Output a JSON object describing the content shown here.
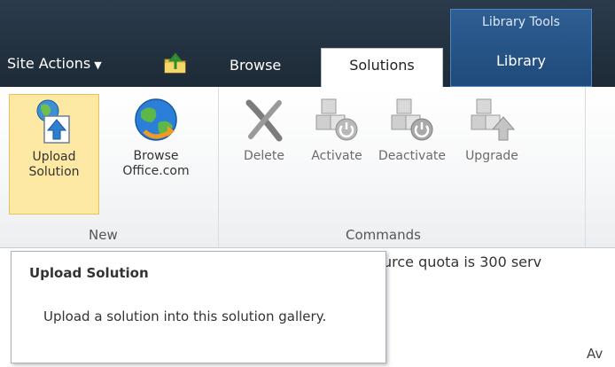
{
  "topbar": {
    "site_actions_label": "Site Actions",
    "site_actions_arrow": "▼",
    "nav_up_icon": "navigate-up-folder-icon",
    "tabs": {
      "browse": "Browse",
      "solutions": "Solutions"
    },
    "contextual_group": {
      "title": "Library Tools",
      "tab_library": "Library"
    }
  },
  "ribbon": {
    "groups": {
      "new": {
        "label": "New",
        "buttons": {
          "upload": {
            "line1": "Upload",
            "line2": "Solution",
            "icon": "upload-solution-icon",
            "state": "hovered"
          },
          "browse_office": {
            "line1": "Browse",
            "line2": "Office.com",
            "icon": "globe-icon"
          }
        }
      },
      "commands": {
        "label": "Commands",
        "buttons": {
          "delete": {
            "label": "Delete",
            "icon": "delete-x-icon",
            "state": "disabled"
          },
          "activate": {
            "label": "Activate",
            "icon": "activate-cubes-icon",
            "state": "disabled"
          },
          "deactivate": {
            "label": "Deactivate",
            "icon": "deactivate-cubes-icon",
            "state": "disabled"
          },
          "upgrade": {
            "label": "Upgrade",
            "icon": "upgrade-cubes-icon",
            "state": "disabled"
          }
        }
      }
    }
  },
  "tooltip": {
    "title": "Upload Solution",
    "description": "Upload a solution into this solution gallery."
  },
  "page": {
    "quota_text_fragment": "urce quota is 300 serv",
    "av_fragment": "Av"
  },
  "colors": {
    "topbar": "#233240",
    "contextual_group": "#2a5688",
    "hover_highlight": "#fde9a4"
  }
}
